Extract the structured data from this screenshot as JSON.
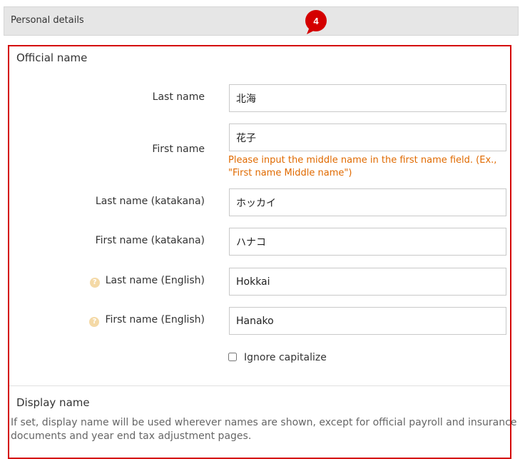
{
  "section": {
    "title": "Personal details"
  },
  "step_badge": {
    "number": "4",
    "color": "#d40000"
  },
  "official_name": {
    "title": "Official name",
    "fields": {
      "last_name": {
        "label": "Last name",
        "value": "北海"
      },
      "first_name": {
        "label": "First name",
        "value": "花子"
      },
      "first_name_hint": "Please input the middle name in the first name field. (Ex., \"First name Middle name\")",
      "last_name_katakana": {
        "label": "Last name (katakana)",
        "value": "ホッカイ"
      },
      "first_name_katakana": {
        "label": "First name (katakana)",
        "value": "ハナコ"
      },
      "last_name_english": {
        "label": "Last name (English)",
        "value": "Hokkai"
      },
      "first_name_english": {
        "label": "First name (English)",
        "value": "Hanako"
      }
    },
    "ignore_capitalize": {
      "label": "Ignore capitalize",
      "checked": false
    }
  },
  "display_name": {
    "title": "Display name",
    "description": "If set, display name will be used wherever names are shown, except for official payroll and insurance documents and year end tax adjustment pages."
  }
}
